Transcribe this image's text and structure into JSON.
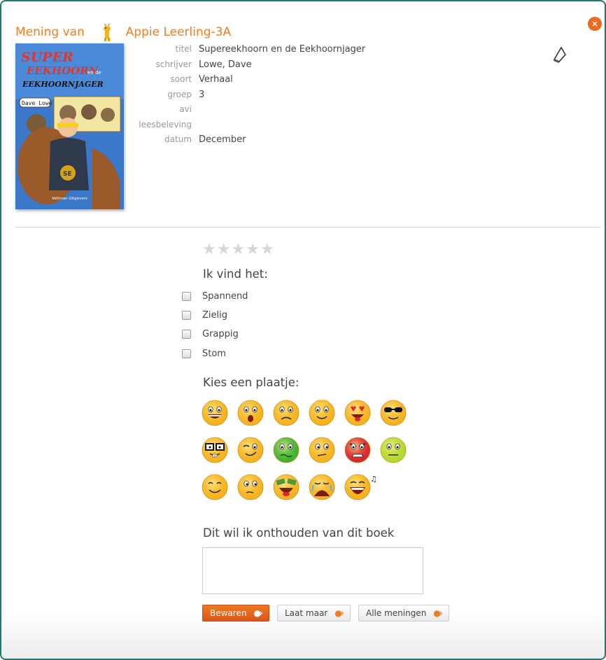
{
  "header": {
    "prefix": "Mening van",
    "student": "Appie Leerling-3A"
  },
  "close_label": "×",
  "cover": {
    "title_line1": "SUPER",
    "title_line2": "EEKHOORN",
    "title_small": "en de",
    "title_line3": "EEKHOORNJAGER",
    "author": "Dave Lowe",
    "badge": "SE",
    "publisher": "Veltman Uitgevers"
  },
  "meta": [
    {
      "label": "titel",
      "value": "Supereekhoorn en de Eekhoornjager"
    },
    {
      "label": "schrijver",
      "value": "Lowe, Dave"
    },
    {
      "label": "soort",
      "value": "Verhaal"
    },
    {
      "label": "groep",
      "value": "3"
    },
    {
      "label": "avi",
      "value": ""
    },
    {
      "label": "leesbeleving",
      "value": ""
    },
    {
      "label": "datum",
      "value": "December"
    }
  ],
  "rating": {
    "stars": [
      "★",
      "★",
      "★",
      "★",
      "★"
    ],
    "value": 0
  },
  "feelings": {
    "title": "Ik vind het:",
    "options": [
      "Spannend",
      "Zielig",
      "Grappig",
      "Stom"
    ]
  },
  "pictures": {
    "title": "Kies een plaatje:",
    "icons": [
      "laughing-face-icon",
      "surprised-face-icon",
      "worried-face-icon",
      "angel-face-icon",
      "heart-eyes-face-icon",
      "sunglasses-face-icon",
      "nerd-face-icon",
      "winking-face-icon",
      "sick-face-icon",
      "confused-face-icon",
      "angry-face-icon",
      "neutral-face-icon",
      "smiling-face-icon",
      "thinking-face-icon",
      "money-eyes-face-icon",
      "crying-face-icon",
      "singing-face-icon"
    ],
    "colors": {
      "yellow": "#f7b21e",
      "green": "#3fb234",
      "red": "#d9262b",
      "lime": "#b3d92e"
    }
  },
  "remember": {
    "title": "Dit wil ik onthouden van dit boek",
    "value": ""
  },
  "buttons": {
    "save": "Bewaren",
    "cancel": "Laat maar",
    "all": "Alle meningen"
  },
  "colors": {
    "accent": "#ef7d22",
    "frame": "#1e7a6e"
  }
}
